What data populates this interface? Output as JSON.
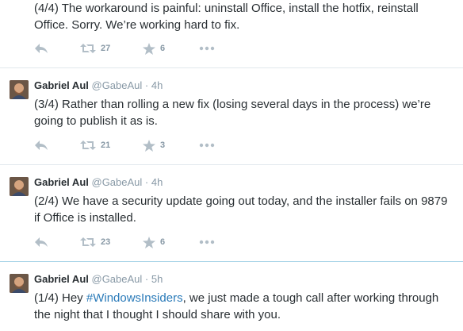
{
  "tweets": [
    {
      "text": "(4/4) The workaround is painful: uninstall Office, install the hotfix, reinstall Office. Sorry. We’re working hard to fix.",
      "retweets": "27",
      "favorites": "6"
    },
    {
      "name": "Gabriel Aul",
      "handle": "@GabeAul",
      "separator": "·",
      "time": "4h",
      "text": "(3/4) Rather than rolling a new fix (losing several days in the process) we’re going to publish it as is.",
      "retweets": "21",
      "favorites": "3"
    },
    {
      "name": "Gabriel Aul",
      "handle": "@GabeAul",
      "separator": "·",
      "time": "4h",
      "text": "(2/4) We have a security update going out today, and the installer fails on 9879 if Office is installed.",
      "retweets": "23",
      "favorites": "6"
    },
    {
      "name": "Gabriel Aul",
      "handle": "@GabeAul",
      "separator": "·",
      "time": "5h",
      "text_before": "(1/4) Hey ",
      "hashtag": "#WindowsInsiders",
      "text_after": ", we just made a tough call after working through the night that I thought I should share with you."
    }
  ],
  "colors": {
    "text": "#292f33",
    "muted": "#8899a6",
    "icon": "#b2bec7",
    "hashtag": "#2b7bb9",
    "border": "#e1e8ed"
  },
  "icons": [
    "reply-icon",
    "retweet-icon",
    "favorite-star-icon",
    "more-dots-icon"
  ]
}
